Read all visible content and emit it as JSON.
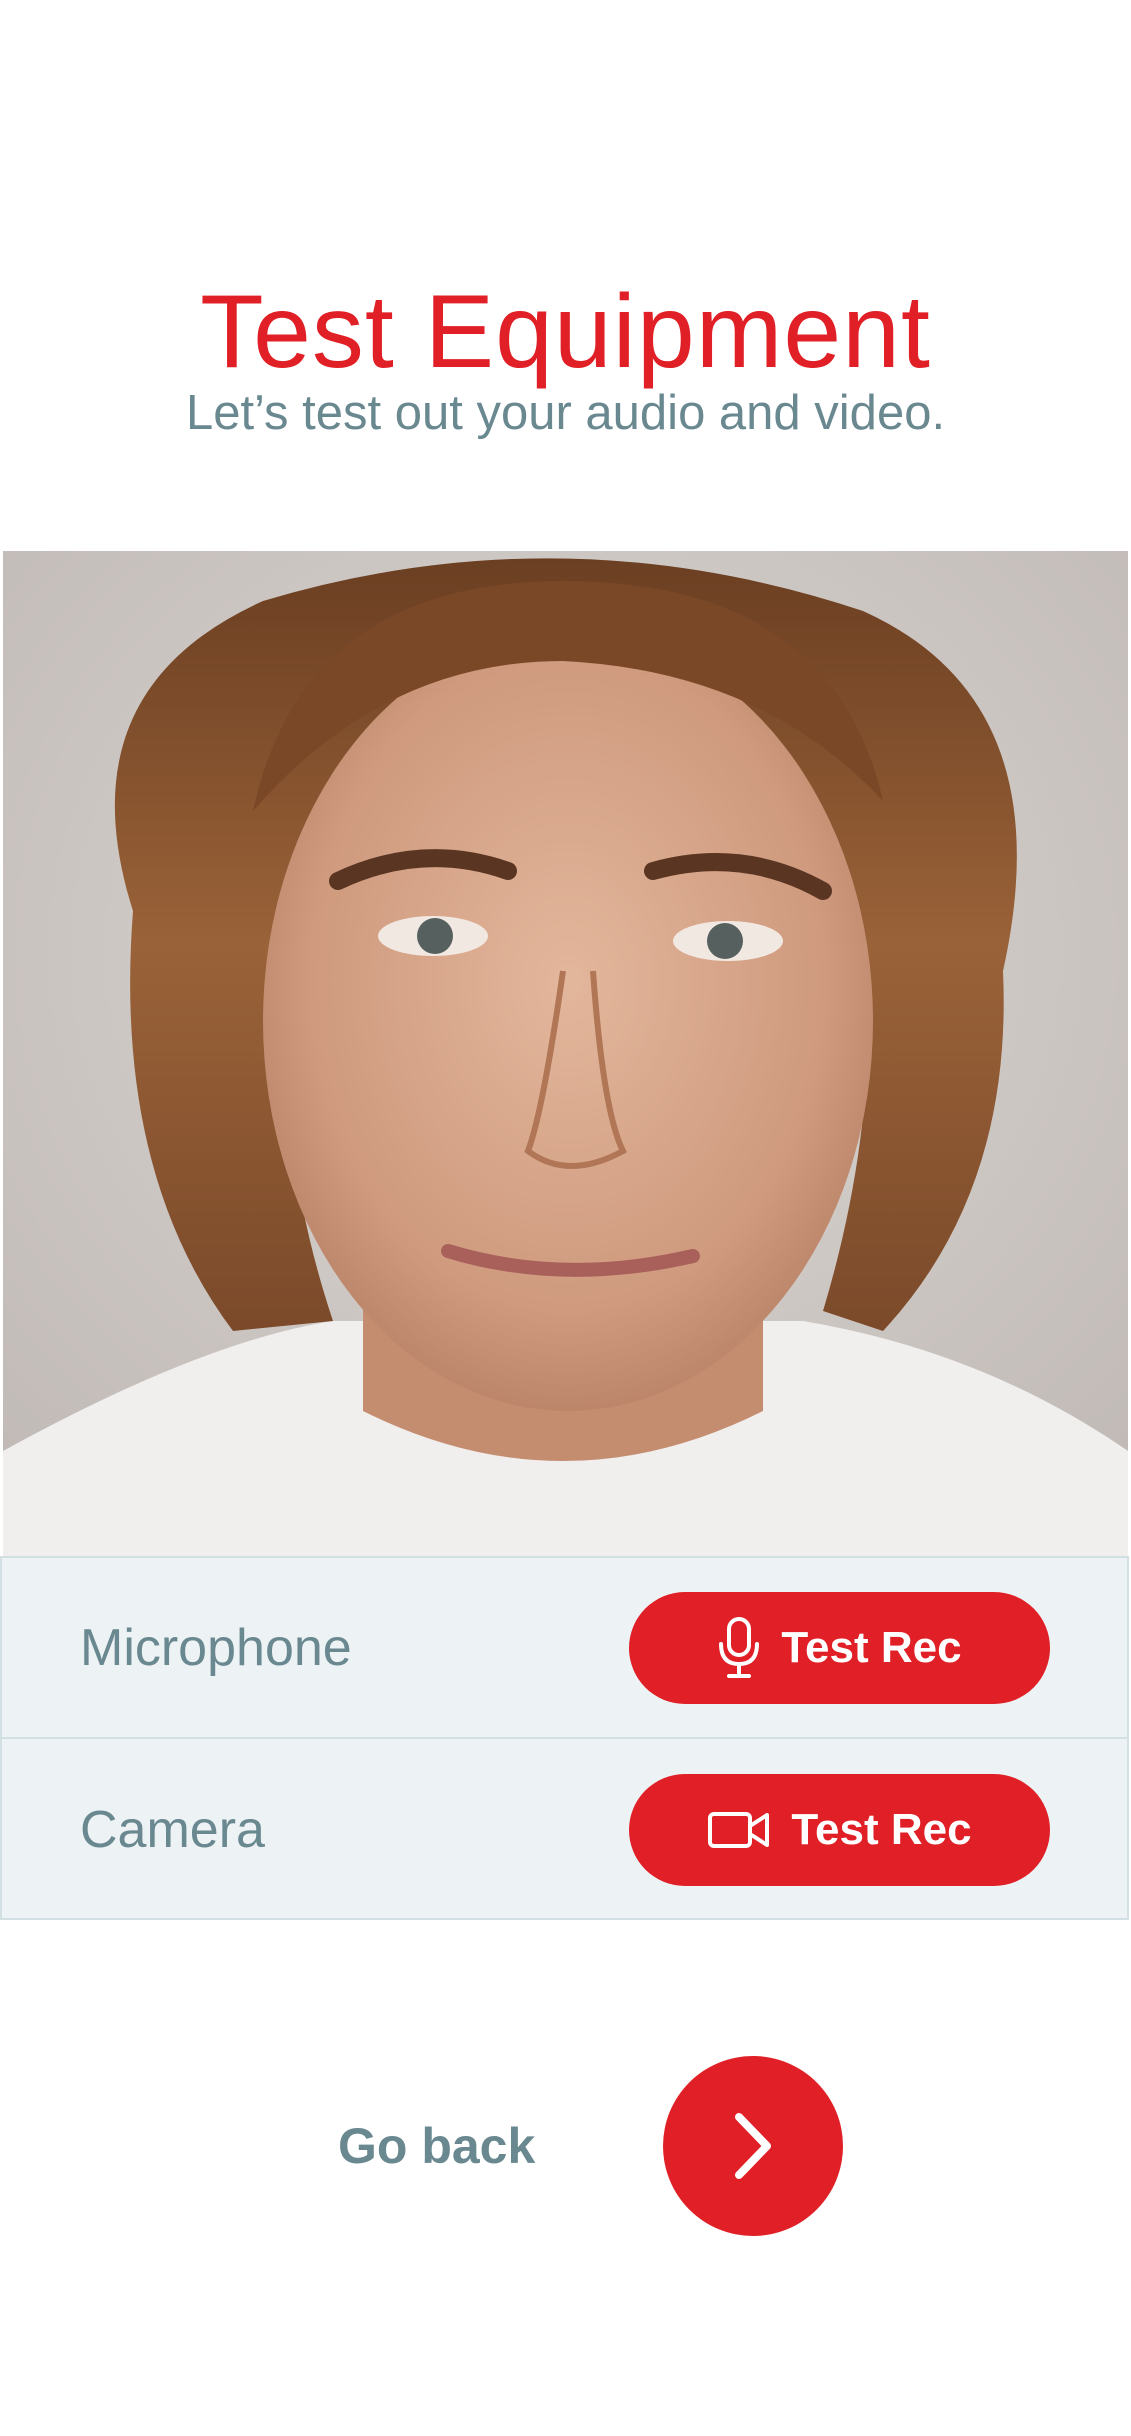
{
  "header": {
    "title": "Test Equipment",
    "subtitle": "Let’s test out your audio and video."
  },
  "preview": {
    "icon": "camera-preview-image"
  },
  "devices": [
    {
      "label": "Microphone",
      "button_label": "Test Rec",
      "icon": "microphone-icon"
    },
    {
      "label": "Camera",
      "button_label": "Test Rec",
      "icon": "video-camera-icon"
    }
  ],
  "footer": {
    "back_label": "Go back",
    "next_icon": "chevron-right-icon"
  },
  "colors": {
    "accent": "#e02026",
    "text_muted": "#6a8890",
    "panel_bg": "#edf2f5",
    "panel_border": "#d3e0e3"
  }
}
